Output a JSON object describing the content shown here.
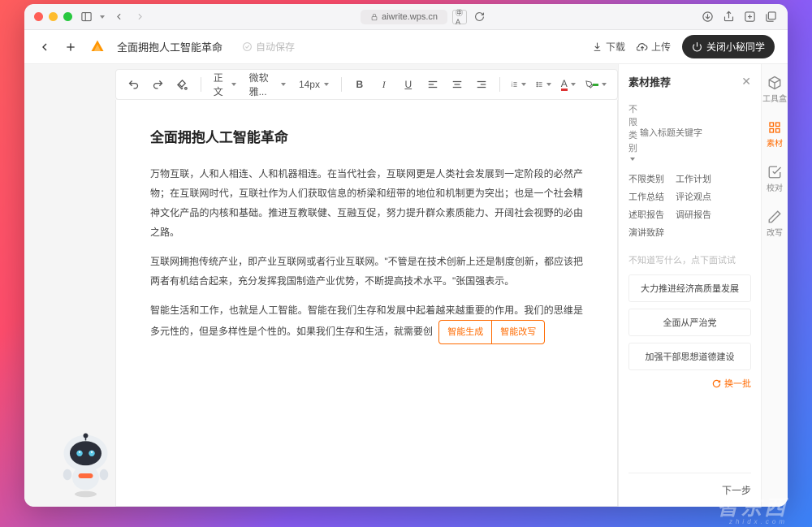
{
  "browser": {
    "url": "aiwrite.wps.cn"
  },
  "app": {
    "title": "全面拥抱人工智能革命",
    "autosave": "自动保存",
    "download": "下载",
    "upload": "上传",
    "close_assistant": "关闭小秘同学"
  },
  "toolbar": {
    "style": "正文",
    "font": "微软雅...",
    "size": "14px"
  },
  "doc": {
    "heading": "全面拥抱人工智能革命",
    "p1": "万物互联，人和人相连、人和机器相连。在当代社会，互联网更是人类社会发展到一定阶段的必然产物；在互联网时代，互联社作为人们获取信息的桥梁和纽带的地位和机制更为突出；也是一个社会精神文化产品的内核和基础。推进互教联健、互融互促，努力提升群众素质能力、开阔社会视野的必由之路。",
    "p2": "互联网拥抱传统产业，即产业互联网或者行业互联网。\"不管是在技术创新上还是制度创新，都应该把两者有机结合起来，充分发挥我国制造产业优势，不断提高技术水平。\"张国强表示。",
    "p3": "智能生活和工作，也就是人工智能。智能在我们生存和发展中起着越来越重要的作用。我们的思维是多元性的，但是多样性是个性的。如果我们生存和生活，就需要创",
    "gen": "智能生成",
    "rewrite": "智能改写"
  },
  "panel": {
    "title": "素材推荐",
    "filter_label": "不限类别",
    "filter_placeholder": "输入标题关键字",
    "cats": [
      "不限类别",
      "工作计划",
      "工作总结",
      "评论观点",
      "述职报告",
      "调研报告",
      "演讲致辞"
    ],
    "hint": "不知道写什么，点下面试试",
    "cards": [
      "大力推进经济高质量发展",
      "全面从严治党",
      "加强干部思想道德建设"
    ],
    "refresh": "换一批",
    "next": "下一步"
  },
  "sidetabs": {
    "toolbox": "工具盒",
    "material": "素材",
    "proofread": "校对",
    "rewrite": "改写"
  },
  "watermark": {
    "main": "智东西",
    "sub": "zhidx.com"
  }
}
